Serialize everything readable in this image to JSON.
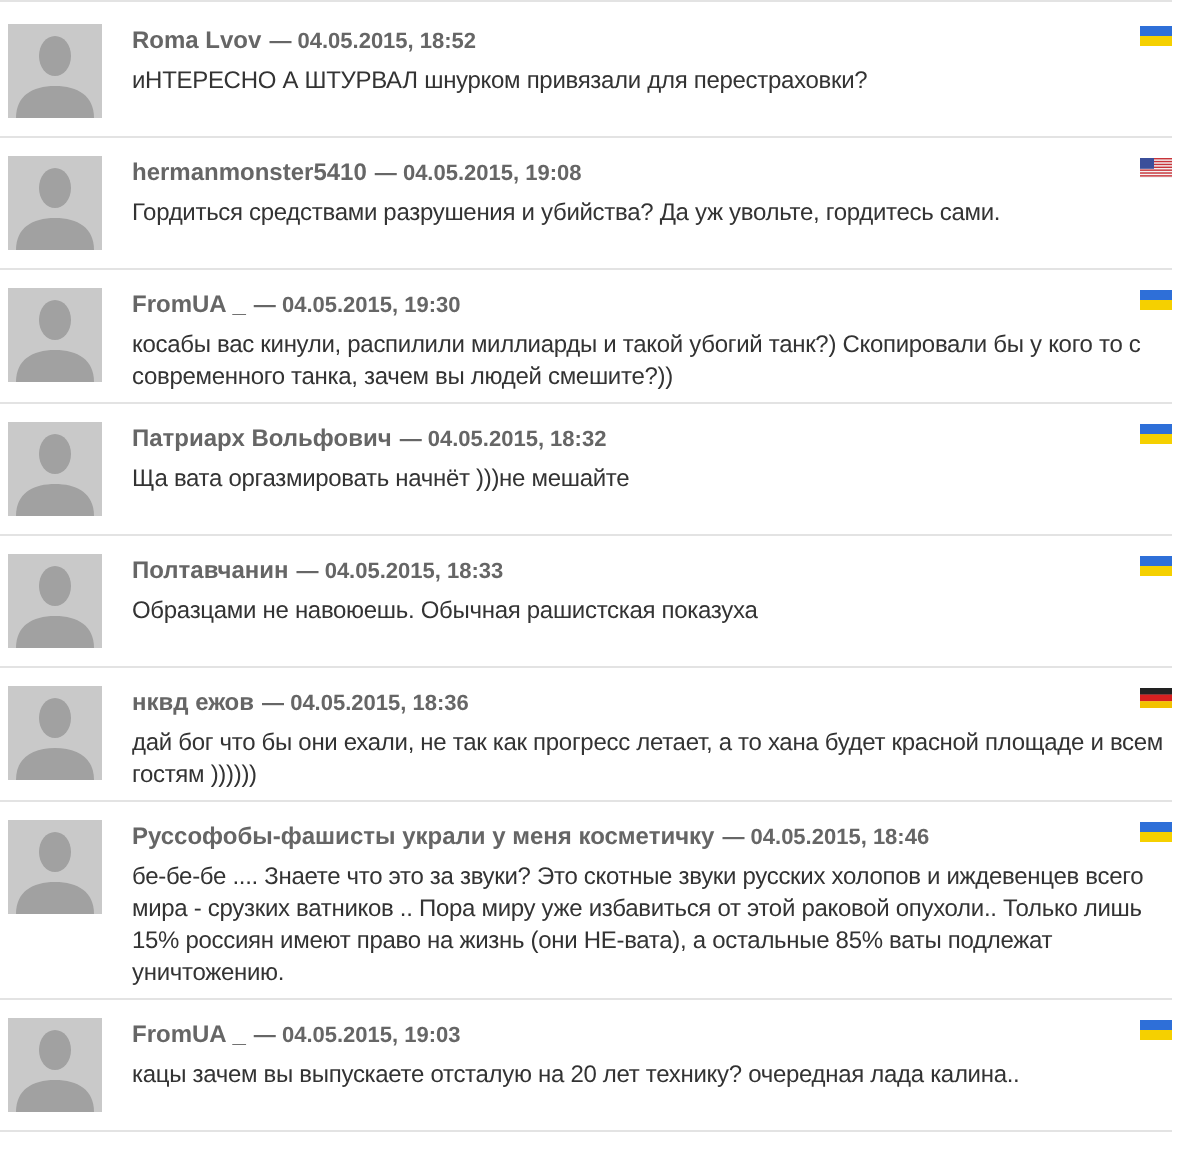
{
  "comments": [
    {
      "author": "Roma Lvov",
      "date": "— 04.05.2015, 18:52",
      "text": "иНТЕРЕСНО А ШТУРВАЛ шнурком привязали для перестраховки?",
      "kind": "ua"
    },
    {
      "author": "hermanmonster5410",
      "date": "— 04.05.2015, 19:08",
      "text": "Гордиться средствами разрушения и убийства? Да уж увольте, гордитесь сами.",
      "kind": "us"
    },
    {
      "author": "FromUA _",
      "date": "— 04.05.2015, 19:30",
      "text": "косабы вас кинули, распилили миллиарды и такой убогий танк?) Скопировали бы у кого то с современного танка, зачем вы людей смешите?))",
      "kind": "ua"
    },
    {
      "author": "Патриарх Вольфович",
      "date": "— 04.05.2015, 18:32",
      "text": "Ща вата оргазмировать начнёт )))не мешайте",
      "kind": "ua"
    },
    {
      "author": "Полтавчанин",
      "date": "— 04.05.2015, 18:33",
      "text": "Образцами не навоюешь. Обычная рашистская показуха",
      "kind": "ua"
    },
    {
      "author": "нквд ежов",
      "date": "— 04.05.2015, 18:36",
      "text": "дай бог что бы они ехали, не так как прогресс летает, а то хана будет красной площаде и всем гостям ))))))",
      "kind": "de"
    },
    {
      "author": "Руссофобы-фашисты украли у меня косметичку",
      "date": "— 04.05.2015, 18:46",
      "text": "бе-бе-бе .... Знаете что это за звуки? Это скотные звуки русских холопов и иждевенцев всего мира - срузких ватников .. Пора миру уже избавиться от этой раковой опухоли.. Только лишь 15% россиян имеют право на жизнь (они НЕ-вата), а остальные 85% ваты подлежат уничтожению.",
      "kind": "ua"
    },
    {
      "author": "FromUA _",
      "date": "— 04.05.2015, 19:03",
      "text": "кацы зачем вы выпускаете отсталую на 20 лет технику? очередная лада калина..",
      "kind": "ua"
    }
  ]
}
